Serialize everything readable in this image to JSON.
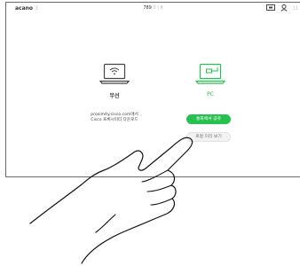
{
  "topbar": {
    "brand": "acano",
    "brand_suffix": "3",
    "room_code": "789",
    "room_status": "0 | 8",
    "time": "11"
  },
  "icons": {
    "screen": "screen-share-icon",
    "person": "person-icon"
  },
  "options": {
    "wireless": {
      "label": "무선",
      "desc_line1": "proximity.cisco.com에서",
      "desc_line2": "Cisco 프록시미티 다운로드"
    },
    "pc": {
      "label": "PC",
      "share_button": "통화에서 공유",
      "preview_button": "로컬 미리 보기"
    }
  },
  "colors": {
    "accent": "#27c14f",
    "border": "#6b6b6b"
  }
}
